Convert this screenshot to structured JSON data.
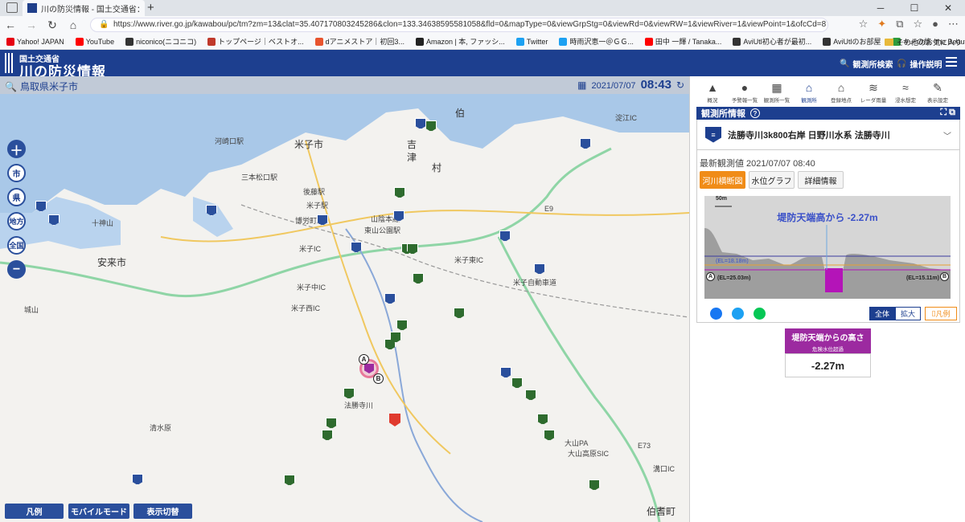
{
  "browser": {
    "tab_title": "川の防災情報 - 国土交通省：観測所",
    "new_tab": "+",
    "url": "https://www.river.go.jp/kawabou/pc/tm?zm=13&clat=35.407170803245286&clon=133.34638595581058&fld=0&mapType=0&viewGrpStg=0&viewRd=0&viewRW=1&viewRiver=1&viewPoint=1&ofcCd=87000&itmkndCd=3...",
    "bookmarks": [
      {
        "label": "Yahoo! JAPAN",
        "color": "#e60012"
      },
      {
        "label": "YouTube",
        "color": "#ff0000"
      },
      {
        "label": "niconico(ニコニコ)",
        "color": "#333333"
      },
      {
        "label": "トップページ｜ベストオ...",
        "color": "#c0392b"
      },
      {
        "label": "dアニメストア｜初回3...",
        "color": "#e8542e"
      },
      {
        "label": "Amazon | 本, ファッシ...",
        "color": "#222222"
      },
      {
        "label": "Twitter",
        "color": "#1da1f2"
      },
      {
        "label": "時雨沢恵一＠ＧＧ...",
        "color": "#1da1f2"
      },
      {
        "label": "田中 一輝 / Tanaka...",
        "color": "#ff0000"
      },
      {
        "label": "AviUtl初心者が最初...",
        "color": "#333333"
      },
      {
        "label": "AviUtlのお部屋",
        "color": "#333333"
      },
      {
        "label": "キノの旅 -the Beautif...",
        "color": "#2e9b3e"
      },
      {
        "label": "https://twitter.com/...",
        "color": "#1da1f2"
      }
    ],
    "bookmarks_other": "その他のお気に入り"
  },
  "header": {
    "org": "国土交通省",
    "title": "川の防災情報",
    "search_label": "観測所検索",
    "help_label": "操作説明"
  },
  "map": {
    "location": "鳥取県米子市",
    "date": "2021/07/07",
    "time": "08:43",
    "tools": [
      "市",
      "県",
      "地方",
      "全国"
    ],
    "bottom_buttons": [
      "凡例",
      "モバイルモード",
      "表示切替"
    ],
    "places": [
      {
        "label": "米子市",
        "big": true
      },
      {
        "label": "安来市",
        "big": true
      },
      {
        "label": "伯",
        "big": true
      },
      {
        "label": "吉",
        "big": true
      },
      {
        "label": "津",
        "big": true
      },
      {
        "label": "村",
        "big": true
      },
      {
        "label": "河崎口駅",
        "big": false
      },
      {
        "label": "三本松口駅",
        "big": false
      },
      {
        "label": "後藤駅",
        "big": false
      },
      {
        "label": "博労町駅",
        "big": false
      },
      {
        "label": "米子駅",
        "big": false
      },
      {
        "label": "東山公園駅",
        "big": false
      },
      {
        "label": "米子IC",
        "big": false
      },
      {
        "label": "米子中IC",
        "big": false
      },
      {
        "label": "米子西IC",
        "big": false
      },
      {
        "label": "米子東IC",
        "big": false
      },
      {
        "label": "淀江IC",
        "big": false
      },
      {
        "label": "大山PA",
        "big": false
      },
      {
        "label": "大山高原SIC",
        "big": false
      },
      {
        "label": "清水原",
        "big": false
      },
      {
        "label": "十神山",
        "big": false
      },
      {
        "label": "城山",
        "big": false
      },
      {
        "label": "溝口IC",
        "big": false
      },
      {
        "label": "伯耆町",
        "big": true
      },
      {
        "label": "山陰本線",
        "big": false
      },
      {
        "label": "米子自動車道",
        "big": false
      },
      {
        "label": "法勝寺川",
        "big": false
      },
      {
        "label": "E9",
        "big": false
      },
      {
        "label": "E73",
        "big": false
      }
    ],
    "marker_a": "A",
    "marker_b": "B"
  },
  "panel": {
    "nav": [
      {
        "label": "概況",
        "glyph": "▲"
      },
      {
        "label": "予警報一覧",
        "glyph": "●"
      },
      {
        "label": "観測所一覧",
        "glyph": "▦"
      },
      {
        "label": "観測所",
        "glyph": "⌂"
      },
      {
        "label": "登録地点",
        "glyph": "⌂"
      },
      {
        "label": "レーダ雨量",
        "glyph": "≋"
      },
      {
        "label": "浸水想定",
        "glyph": "≈"
      },
      {
        "label": "表示設定",
        "glyph": "✎"
      }
    ],
    "section_title": "観測所情報",
    "help": "?",
    "station_name": "法勝寺川3k800右岸  日野川水系  法勝寺川",
    "latest_label": "最新観測値 2021/07/07 08:40",
    "tabs": [
      "河川横断図",
      "水位グラフ",
      "詳細情報"
    ],
    "graph": {
      "scale": "50m",
      "headline": "堤防天端高から -2.27m",
      "el_mid": "(EL=18.18m)",
      "el_left": "(EL=25.03m)",
      "el_right": "(EL=15.11m)",
      "a": "A",
      "b": "B"
    },
    "zoom_all": "全体",
    "zoom_in": "拡大",
    "legend": "凡例",
    "stat_title": "堤防天端からの高さ",
    "stat_sub": "危険水位超過",
    "stat_value": "-2.27m",
    "colors": {
      "header": "#1d3f8f",
      "accent": "#f08c18",
      "danger": "#9c2aa0"
    }
  }
}
